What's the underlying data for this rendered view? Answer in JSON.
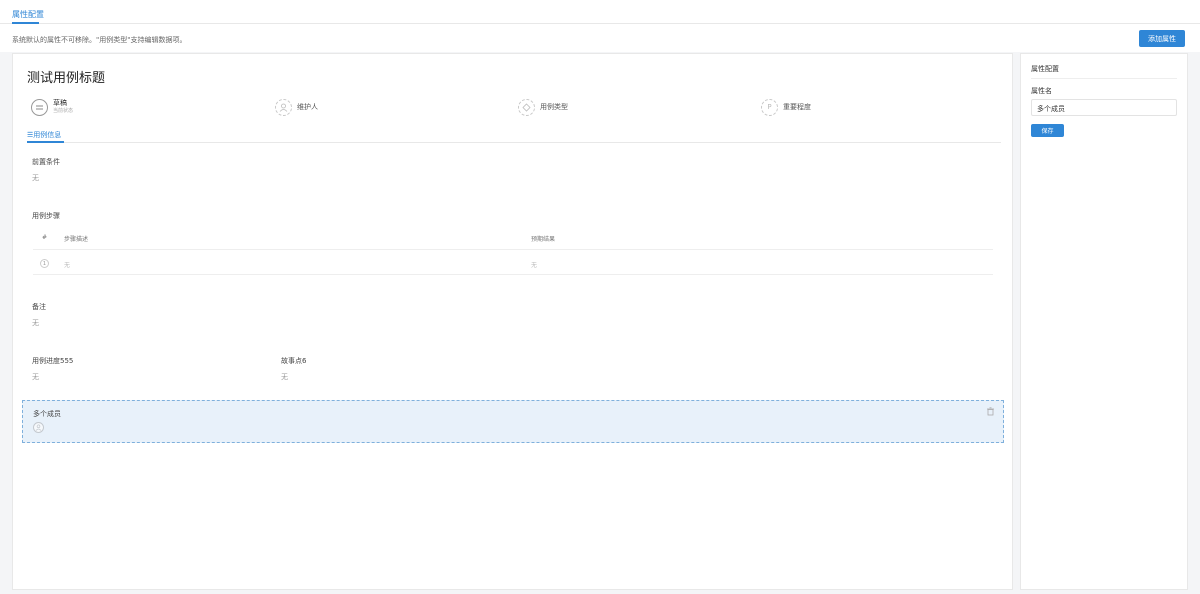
{
  "header": {
    "tab_label": "属性配置"
  },
  "hint": {
    "text": "系统默认的属性不可移除。\"用例类型\"支持编辑数据项。"
  },
  "toolbar": {
    "add_label": "添加属性"
  },
  "case": {
    "title": "测试用例标题",
    "meta": [
      {
        "label": "草稿",
        "sub": "当前状态",
        "icon": "status-icon"
      },
      {
        "label": "维护人",
        "icon": "user-icon"
      },
      {
        "label": "用例类型",
        "icon": "type-icon"
      },
      {
        "label": "重要程度",
        "icon": "priority-icon",
        "glyph": "P"
      }
    ],
    "subtab": "用例信息",
    "precondition": {
      "label": "前置条件",
      "value": "无"
    },
    "steps": {
      "label": "用例步骤",
      "columns": [
        "#",
        "步骤描述",
        "预期结果"
      ],
      "rows": [
        {
          "num": "1",
          "desc": "无",
          "expected": "无"
        }
      ]
    },
    "remark": {
      "label": "备注",
      "value": "无"
    },
    "progress": {
      "label": "用例进度555",
      "value": "无"
    },
    "story_points": {
      "label": "故事点6",
      "value": "无"
    },
    "members": {
      "label": "多个成员"
    }
  },
  "side": {
    "title": "属性配置",
    "name_label": "属性名",
    "name_value": "多个成员",
    "save_label": "保存"
  },
  "colors": {
    "accent": "#2f86d6",
    "selected_bg": "#e8f1fa"
  }
}
